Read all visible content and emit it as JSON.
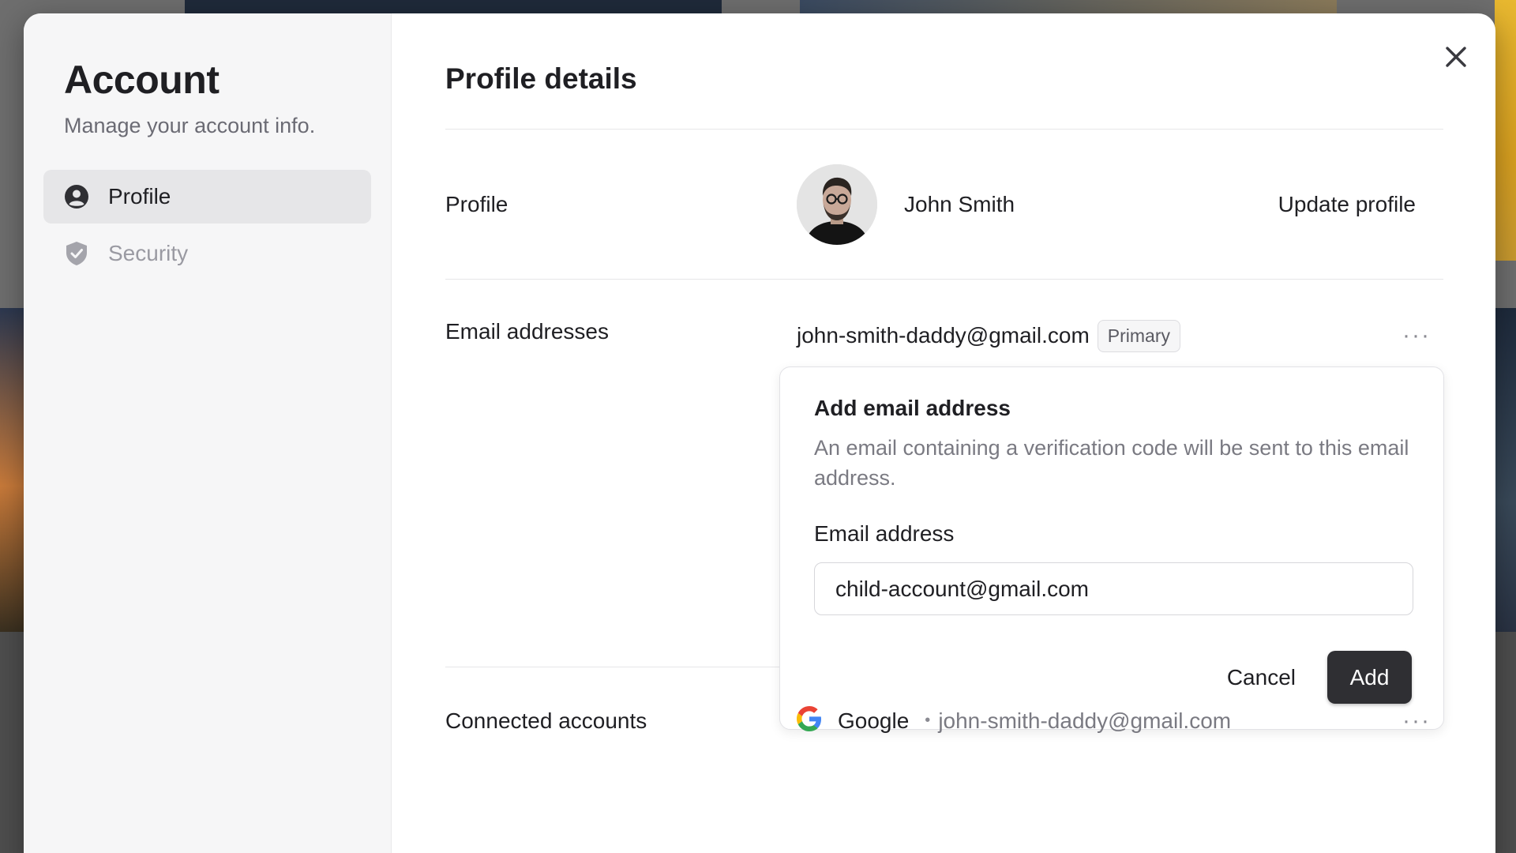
{
  "sidebar": {
    "title": "Account",
    "subtitle": "Manage your account info.",
    "items": [
      {
        "label": "Profile",
        "icon": "user-circle-icon",
        "active": true
      },
      {
        "label": "Security",
        "icon": "shield-check-icon",
        "active": false
      }
    ]
  },
  "main": {
    "title": "Profile details",
    "profile": {
      "label": "Profile",
      "name": "John Smith",
      "update_label": "Update profile"
    },
    "emails": {
      "label": "Email addresses",
      "primary_email": "john-smith-daddy@gmail.com",
      "primary_badge": "Primary",
      "menu_label": "···"
    },
    "add_email": {
      "title": "Add email address",
      "description": "An email containing a verification code will be sent to this email address.",
      "field_label": "Email address",
      "field_value": "child-account@gmail.com",
      "cancel_label": "Cancel",
      "add_label": "Add"
    },
    "connected": {
      "label": "Connected accounts",
      "provider": "Google",
      "provider_icon": "google-icon",
      "email": "john-smith-daddy@gmail.com",
      "menu_label": "···"
    }
  },
  "colors": {
    "primary_button": "#2f2f33",
    "sidebar_bg": "#f6f6f7",
    "active_item_bg": "#e6e6e8"
  }
}
